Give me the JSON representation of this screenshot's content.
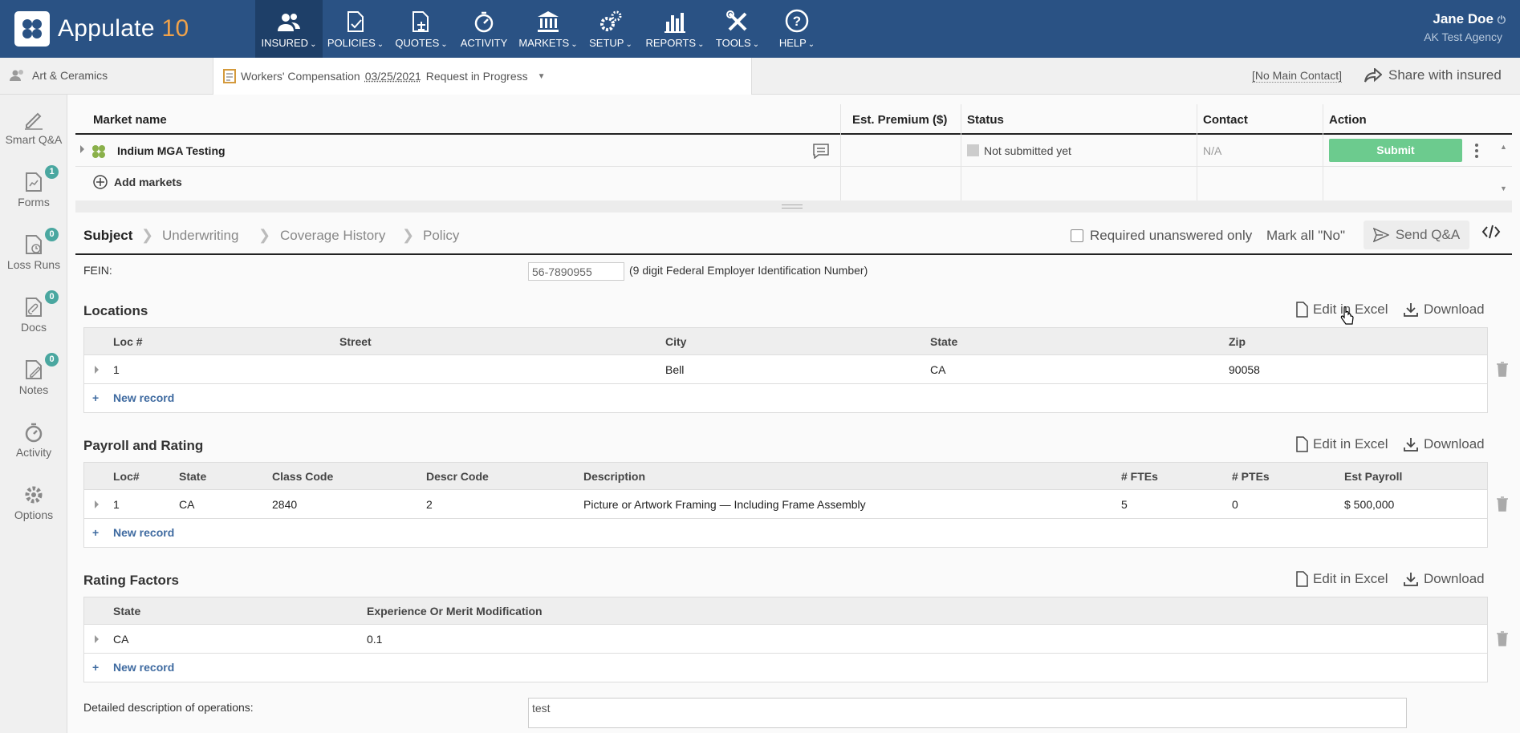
{
  "app": {
    "name": "Appulate",
    "version": "10"
  },
  "nav": [
    {
      "label": "INSURED",
      "active": true,
      "icon": "users-icon"
    },
    {
      "label": "POLICIES",
      "active": false,
      "icon": "policy-check-icon"
    },
    {
      "label": "QUOTES",
      "active": false,
      "icon": "quote-scale-icon"
    },
    {
      "label": "ACTIVITY",
      "active": false,
      "icon": "stopwatch-icon"
    },
    {
      "label": "MARKETS",
      "active": false,
      "icon": "bank-icon"
    },
    {
      "label": "SETUP",
      "active": false,
      "icon": "gears-icon"
    },
    {
      "label": "REPORTS",
      "active": false,
      "icon": "bar-chart-icon"
    },
    {
      "label": "TOOLS",
      "active": false,
      "icon": "tools-icon"
    },
    {
      "label": "HELP",
      "active": false,
      "icon": "help-circle-icon"
    }
  ],
  "user": {
    "name": "Jane Doe",
    "agency": "AK Test Agency"
  },
  "subbar": {
    "insured": "Art & Ceramics",
    "policy_type": "Workers' Compensation",
    "policy_date": "03/25/2021",
    "policy_status": "Request in Progress",
    "main_contact": "[No Main Contact]",
    "share": "Share with insured"
  },
  "sidebar": [
    {
      "label": "Smart Q&A",
      "badge": null,
      "icon": "smart-qa-icon"
    },
    {
      "label": "Forms",
      "badge": "1",
      "icon": "forms-icon"
    },
    {
      "label": "Loss Runs",
      "badge": "0",
      "icon": "loss-runs-icon"
    },
    {
      "label": "Docs",
      "badge": "0",
      "icon": "docs-icon"
    },
    {
      "label": "Notes",
      "badge": "0",
      "icon": "notes-icon"
    },
    {
      "label": "Activity",
      "badge": null,
      "icon": "activity-icon"
    },
    {
      "label": "Options",
      "badge": null,
      "icon": "options-gear-icon"
    }
  ],
  "markets": {
    "headers": {
      "name": "Market name",
      "premium": "Est. Premium ($)",
      "status": "Status",
      "contact": "Contact",
      "action": "Action"
    },
    "rows": [
      {
        "name": "Indium MGA Testing",
        "status": "Not submitted yet",
        "contact": "N/A",
        "action": "Submit"
      }
    ],
    "add": "Add markets"
  },
  "tabs": [
    "Subject",
    "Underwriting",
    "Coverage History",
    "Policy"
  ],
  "toolbar": {
    "required_only": "Required unanswered only",
    "mark_all": "Mark all \"No\"",
    "send": "Send Q&A"
  },
  "fein": {
    "label": "FEIN:",
    "value": "56-7890955",
    "hint": "(9 digit Federal Employer Identification Number)"
  },
  "actions": {
    "edit_excel": "Edit in Excel",
    "download": "Download",
    "new_record": "New record"
  },
  "locations": {
    "title": "Locations",
    "columns": [
      "Loc #",
      "Street",
      "City",
      "State",
      "Zip"
    ],
    "rows": [
      [
        "1",
        "",
        "Bell",
        "CA",
        "90058"
      ]
    ]
  },
  "payroll": {
    "title": "Payroll and Rating",
    "columns": [
      "Loc#",
      "State",
      "Class Code",
      "Descr Code",
      "Description",
      "# FTEs",
      "# PTEs",
      "Est Payroll"
    ],
    "rows": [
      [
        "1",
        "CA",
        "2840",
        "2",
        "Picture or Artwork Framing — Including Frame Assembly",
        "5",
        "0",
        "$ 500,000"
      ]
    ]
  },
  "rating": {
    "title": "Rating Factors",
    "columns": [
      "State",
      "Experience Or Merit Modification"
    ],
    "rows": [
      [
        "CA",
        "0.1"
      ]
    ]
  },
  "operations": {
    "label": "Detailed description of operations:",
    "value": "test"
  },
  "colors": {
    "topbar": "#2a5284",
    "active_nav": "#1e3f68",
    "submit": "#6ccb8e",
    "badge": "#4aa7a0",
    "accent": "#f0a24a",
    "link": "#3e6aa0"
  }
}
